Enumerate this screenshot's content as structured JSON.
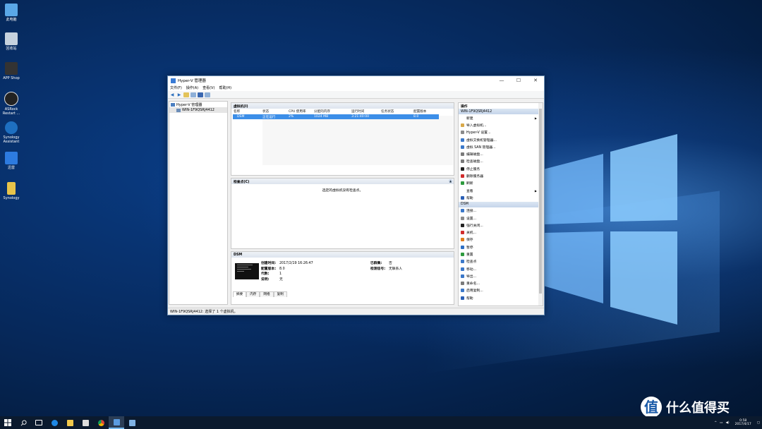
{
  "desktop": {
    "icons": [
      {
        "label": "此电脑"
      },
      {
        "label": "回收站"
      },
      {
        "label": "APP Shop"
      },
      {
        "label": "ASRock Restart ..."
      },
      {
        "label": "Synology Assistant"
      },
      {
        "label": "迅雷"
      },
      {
        "label": "Synology"
      }
    ]
  },
  "window": {
    "title": "Hyper-V 管理器",
    "menu": [
      "文件(F)",
      "操作(A)",
      "查看(V)",
      "帮助(H)"
    ],
    "tree": {
      "root": "Hyper-V 管理器",
      "server": "WIN-1F9QSRJ4412"
    },
    "vm_panel": {
      "title": "虚拟机(I)",
      "columns": [
        "名称",
        "状态",
        "CPU 使用率",
        "分配的内存",
        "运行时间",
        "任务状态",
        "配置版本"
      ],
      "rows": [
        {
          "name": "DSM",
          "state": "正在运行",
          "cpu": "2%",
          "memory": "1024 MB",
          "uptime": "3:21:40:00",
          "task": "",
          "version": "8.0"
        }
      ]
    },
    "checkpoint_panel": {
      "title": "检查点(C)",
      "message": "选定的虚拟机没有检查点。"
    },
    "detail_panel": {
      "title": "DSM",
      "fields": [
        {
          "key": "创建时间:",
          "value": "2017/2/19 16:26:47"
        },
        {
          "key": "配置版本:",
          "value": "8.0"
        },
        {
          "key": "代数:",
          "value": "1"
        },
        {
          "key": "说明:",
          "value": "无"
        }
      ],
      "fields_right": [
        {
          "key": "已群集:",
          "value": "否"
        },
        {
          "key": "检测信号:",
          "value": "无联系人"
        }
      ],
      "tabs": [
        "摘要",
        "内存",
        "网络",
        "复制"
      ]
    },
    "actions": {
      "header": "操作",
      "server_section": "WIN-1F9QSRJ4412",
      "server_items": [
        {
          "label": "新建",
          "arrow": "▶",
          "color": "#ffffff"
        },
        {
          "label": "导入虚拟机...",
          "arrow": "",
          "color": "#d9a94a"
        },
        {
          "label": "Hyper-V 设置...",
          "arrow": "",
          "color": "#8a8a8a"
        },
        {
          "label": "虚拟交换机管理器...",
          "arrow": "",
          "color": "#3b78c9"
        },
        {
          "label": "虚拟 SAN 管理器...",
          "arrow": "",
          "color": "#3b78c9"
        },
        {
          "label": "编辑磁盘...",
          "arrow": "",
          "color": "#7a7a7a"
        },
        {
          "label": "检查磁盘...",
          "arrow": "",
          "color": "#7a7a7a"
        },
        {
          "label": "停止服务",
          "arrow": "",
          "color": "#222222"
        },
        {
          "label": "删除服务器",
          "arrow": "",
          "color": "#d12b2b"
        },
        {
          "label": "刷新",
          "arrow": "",
          "color": "#2e9a3e"
        },
        {
          "label": "查看",
          "arrow": "▶",
          "color": "#ffffff"
        },
        {
          "label": "帮助",
          "arrow": "",
          "color": "#2a5fb5"
        }
      ],
      "vm_section": "DSM",
      "vm_items": [
        {
          "label": "连接...",
          "color": "#3b78c9"
        },
        {
          "label": "设置...",
          "color": "#8a8a8a"
        },
        {
          "label": "强行关闭...",
          "color": "#222222"
        },
        {
          "label": "关机...",
          "color": "#d12b2b"
        },
        {
          "label": "保存",
          "color": "#e07b1a"
        },
        {
          "label": "暂停",
          "color": "#2e6fc4"
        },
        {
          "label": "重置",
          "color": "#2e9a3e"
        },
        {
          "label": "检查点",
          "color": "#3b78c9"
        },
        {
          "label": "移动...",
          "color": "#3b78c9"
        },
        {
          "label": "导出...",
          "color": "#3b78c9"
        },
        {
          "label": "重命名...",
          "color": "#7a7a7a"
        },
        {
          "label": "启用复制...",
          "color": "#3b78c9"
        },
        {
          "label": "帮助",
          "color": "#2a5fb5"
        }
      ]
    },
    "status_text": "WIN-1F9QSRJ4412: 选择了 1 个虚拟机。"
  },
  "taskbar": {
    "time": "0:58",
    "date": "2017/4/17"
  },
  "watermark": {
    "logo": "值",
    "text": "什么值得买"
  }
}
